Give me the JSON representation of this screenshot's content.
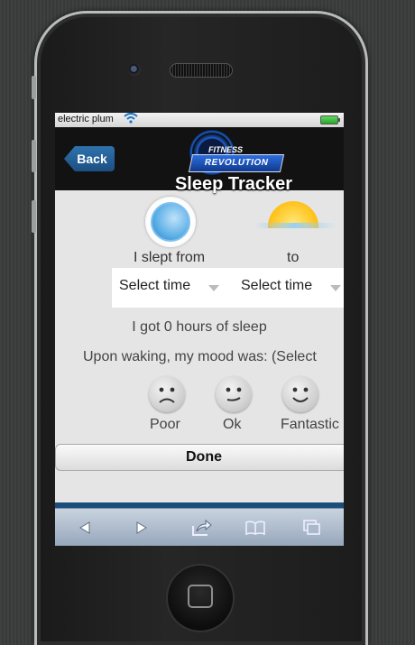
{
  "status_bar": {
    "carrier": "electric plum",
    "wifi_icon": "wifi-icon",
    "battery_icon": "battery-icon"
  },
  "header": {
    "back_label": "Back",
    "title": "Sleep Tracker",
    "logo_top": "FITNESS",
    "logo_main": "REVOLUTION"
  },
  "sleep": {
    "from_label": "I slept from",
    "to_label": "to",
    "from_select": "Select time",
    "to_select": "Select time",
    "summary": "I got 0 hours of sleep"
  },
  "mood": {
    "prompt": "Upon waking, my mood was: (Select",
    "options": [
      {
        "label": "Poor",
        "icon": "sad-face-icon"
      },
      {
        "label": "Ok",
        "icon": "neutral-face-icon"
      },
      {
        "label": "Fantastic",
        "icon": "happy-face-icon"
      }
    ]
  },
  "done_label": "Done",
  "toolbar": [
    "back-arrow-icon",
    "forward-arrow-icon",
    "share-icon",
    "bookmarks-icon",
    "tabs-icon"
  ],
  "colors": {
    "header_bg": "#121212",
    "back_button": "#1c4f82",
    "toolbar": "#95a6bb"
  }
}
